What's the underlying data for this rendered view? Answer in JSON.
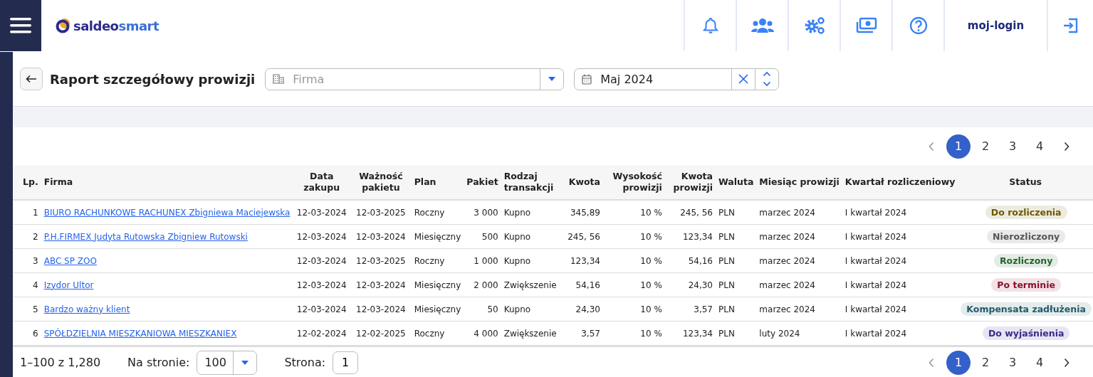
{
  "header": {
    "logo": {
      "part1": "saldeo",
      "part2": "smart"
    },
    "user": "moj-login"
  },
  "page": {
    "title": "Raport szczegółowy prowizji",
    "company_filter": {
      "placeholder": "Firma"
    },
    "month_filter": {
      "value": "Maj 2024"
    }
  },
  "pagination_top": [
    {
      "label": "1",
      "selected": true
    },
    {
      "label": "2",
      "selected": false
    },
    {
      "label": "3",
      "selected": false
    },
    {
      "label": "4",
      "selected": false
    }
  ],
  "table": {
    "columns": [
      {
        "label": "Lp."
      },
      {
        "label": "Firma"
      },
      {
        "label": "Data zakupu"
      },
      {
        "label": "Ważność pakietu"
      },
      {
        "label": "Plan"
      },
      {
        "label": "Pakiet"
      },
      {
        "label": "Rodzaj transakcji"
      },
      {
        "label": "Kwota"
      },
      {
        "label": "Wysokość prowizji"
      },
      {
        "label": "Kwota prowizji"
      },
      {
        "label": "Waluta"
      },
      {
        "label": "Miesiąc prowizji"
      },
      {
        "label": "Kwartał rozliczeniowy"
      },
      {
        "label": "Status"
      }
    ],
    "rows": [
      {
        "lp": "1",
        "firma": "BIURO RACHUNKOWE RACHUNEX Zbigniewa Maciejewska",
        "data": "12-03-2024",
        "waznosc": "12-03-2025",
        "plan": "Roczny",
        "pakiet": "3 000",
        "rodzaj": "Kupno",
        "kwota": "345,89",
        "wysokosc": "10 %",
        "kwota_prowizji": "245, 56",
        "waluta": "PLN",
        "miesiac": "marzec 2024",
        "kwartal": "I kwartał 2024",
        "status": {
          "label": "Do rozliczenia",
          "color": "#6b5a00"
        }
      },
      {
        "lp": "2",
        "firma": "P.H.FIRMEX Judyta Rutowska Zbigniew Rutowski",
        "data": "12-03-2024",
        "waznosc": "12-03-2024",
        "plan": "Miesięczny",
        "pakiet": "500",
        "rodzaj": "Kupno",
        "kwota": "245, 56",
        "wysokosc": "10 %",
        "kwota_prowizji": "123,34",
        "waluta": "PLN",
        "miesiac": "marzec 2024",
        "kwartal": "I kwartał 2024",
        "status": {
          "label": "Nierozliczony",
          "color": "#555555"
        }
      },
      {
        "lp": "3",
        "firma": "ABC SP ZOO",
        "data": "12-03-2024",
        "waznosc": "12-03-2025",
        "plan": "Roczny",
        "pakiet": "1 000",
        "rodzaj": "Kupno",
        "kwota": "123,34",
        "wysokosc": "10 %",
        "kwota_prowizji": "54,16",
        "waluta": "PLN",
        "miesiac": "marzec 2024",
        "kwartal": "I kwartał 2024",
        "status": {
          "label": "Rozliczony",
          "color": "#22662a"
        }
      },
      {
        "lp": "4",
        "firma": "Izydor Ultor",
        "data": "12-03-2024",
        "waznosc": "12-03-2024",
        "plan": "Miesięczny",
        "pakiet": "2 000",
        "rodzaj": "Zwiększenie",
        "kwota": "54,16",
        "wysokosc": "10 %",
        "kwota_prowizji": "24,30",
        "waluta": "PLN",
        "miesiac": "marzec 2024",
        "kwartal": "I kwartał 2024",
        "status": {
          "label": "Po terminie",
          "color": "#8a1230"
        }
      },
      {
        "lp": "5",
        "firma": "Bardzo ważny klient",
        "data": "12-03-2024",
        "waznosc": "12-03-2024",
        "plan": "Miesięczny",
        "pakiet": "50",
        "rodzaj": "Kupno",
        "kwota": "24,30",
        "wysokosc": "10 %",
        "kwota_prowizji": "3,57",
        "waluta": "PLN",
        "miesiac": "marzec 2024",
        "kwartal": "I kwartał 2024",
        "status": {
          "label": "Kompensata zadłużenia",
          "color": "#1f5a66"
        }
      },
      {
        "lp": "6",
        "firma": "SPÓŁDZIELNIA MIESZKANIOWA MIESZKANIEX",
        "data": "12-02-2024",
        "waznosc": "12-02-2025",
        "plan": "Roczny",
        "pakiet": "4 000",
        "rodzaj": "Zwiększenie",
        "kwota": "3,57",
        "wysokosc": "10 %",
        "kwota_prowizji": "123,34",
        "waluta": "PLN",
        "miesiac": "luty 2024",
        "kwartal": "I kwartał 2024",
        "status": {
          "label": "Do wyjaśnienia",
          "color": "#3b2a8a"
        }
      }
    ]
  },
  "footer": {
    "range": "1–100 z 1,280",
    "per_page_label": "Na stronie:",
    "per_page": "100",
    "page_label": "Strona:",
    "page": "1"
  },
  "pagination_bottom": [
    {
      "label": "1",
      "selected": true
    },
    {
      "label": "2",
      "selected": false
    },
    {
      "label": "3",
      "selected": false
    },
    {
      "label": "4",
      "selected": false
    }
  ]
}
